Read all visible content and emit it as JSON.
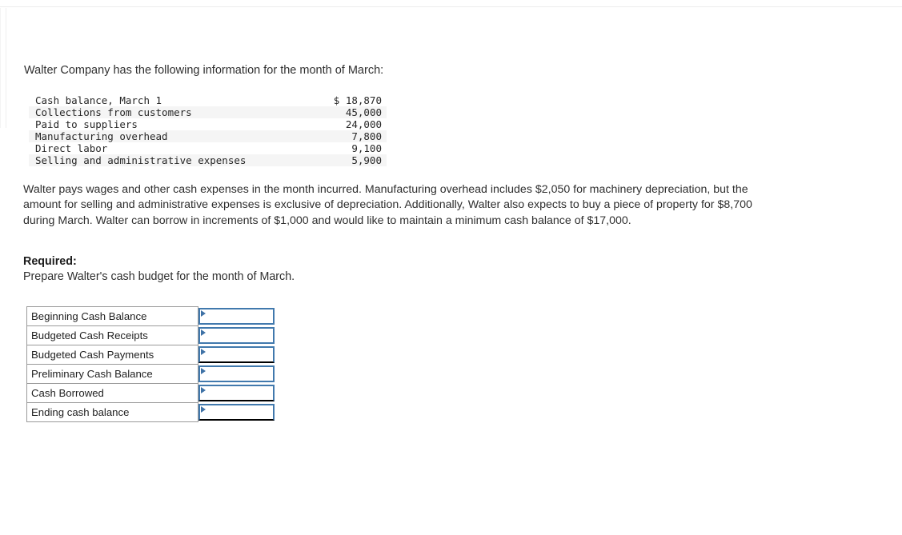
{
  "intro": {
    "text": "Walter Company has the following information for the month of March:"
  },
  "given_data": {
    "rows": [
      {
        "label": "Cash balance, March 1",
        "amount": "$ 18,870"
      },
      {
        "label": "Collections from customers",
        "amount": "45,000"
      },
      {
        "label": "Paid to suppliers",
        "amount": "24,000"
      },
      {
        "label": "Manufacturing overhead",
        "amount": "7,800"
      },
      {
        "label": "Direct labor",
        "amount": "9,100"
      },
      {
        "label": "Selling and administrative expenses",
        "amount": "5,900"
      }
    ]
  },
  "narrative": {
    "text": "Walter pays wages and other cash expenses in the month incurred. Manufacturing overhead includes $2,050 for machinery depreciation, but the amount for selling and administrative expenses is exclusive of depreciation. Additionally, Walter also expects to buy a piece of property for $8,700 during March. Walter can borrow in increments of $1,000 and would like to maintain a minimum cash balance of $17,000."
  },
  "required": {
    "label": "Required:",
    "text": "Prepare Walter's cash budget for the month of March."
  },
  "answer_table": {
    "rows": [
      {
        "label": "Beginning Cash Balance",
        "value": "",
        "placeholder": ""
      },
      {
        "label": "Budgeted Cash Receipts",
        "value": "",
        "placeholder": ""
      },
      {
        "label": "Budgeted Cash Payments",
        "value": "",
        "placeholder": ""
      },
      {
        "label": "Preliminary Cash Balance",
        "value": "",
        "placeholder": ""
      },
      {
        "label": "Cash Borrowed",
        "value": "",
        "placeholder": ""
      },
      {
        "label": "Ending cash balance",
        "value": "",
        "placeholder": ""
      }
    ]
  },
  "colors": {
    "input_border": "#4179ad",
    "rule_line": "#000000",
    "stripe": "#f5f5f5",
    "text": "#2f2f2f"
  },
  "icons": {
    "cell_marker": "triangle-right-marker"
  }
}
